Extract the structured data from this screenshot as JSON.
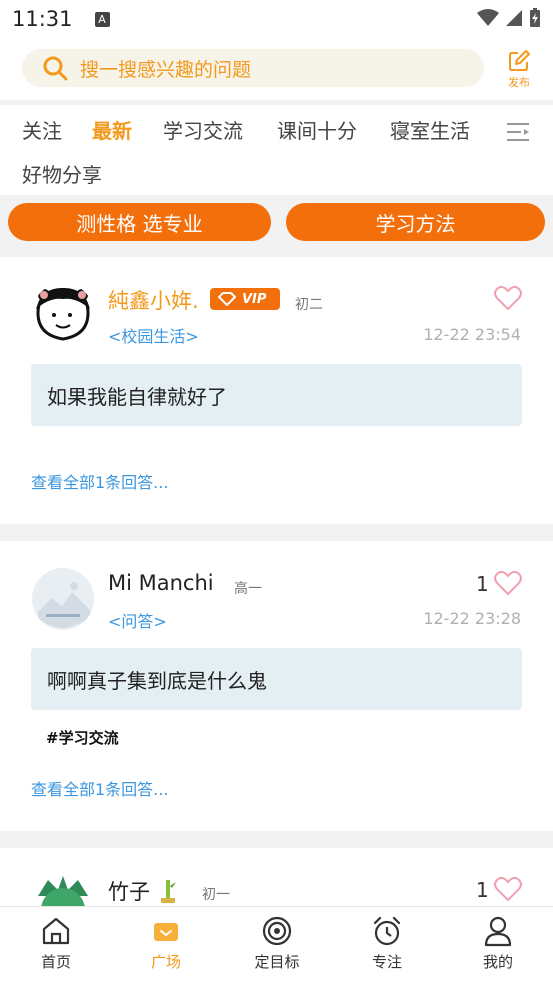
{
  "status_bar": {
    "time": "11:31",
    "notification_icon": "A"
  },
  "search": {
    "placeholder": "搜一搜感兴趣的问题",
    "publish_label": "发布"
  },
  "tabs": [
    "关注",
    "最新",
    "学习交流",
    "课间十分",
    "寝室生活",
    "好物分享"
  ],
  "active_tab": "最新",
  "quick_buttons": [
    "测性格 选专业",
    "学习方法"
  ],
  "posts": [
    {
      "user": "純鑫小姩.",
      "vip": "VIP",
      "grade": "初二",
      "category": "<校园生活>",
      "time": "12-22 23:54",
      "likes": "",
      "content": "如果我能自律就好了",
      "tag": "",
      "more": "查看全部1条回答..."
    },
    {
      "user": "Mi Manchi",
      "grade": "高一",
      "category": "<问答>",
      "time": "12-22 23:28",
      "likes": "1",
      "content": "啊啊真子集到底是什么鬼",
      "tag": "#学习交流",
      "more": "查看全部1条回答..."
    },
    {
      "user": "竹子",
      "grade": "初一",
      "likes": "1"
    }
  ],
  "bottom_nav": [
    "首页",
    "广场",
    "定目标",
    "专注",
    "我的"
  ],
  "active_nav": "广场",
  "colors": {
    "accent": "#f36f0c",
    "accent_text": "#f39a1c",
    "link": "#3b97e0",
    "content_bg": "#e4eff4"
  }
}
